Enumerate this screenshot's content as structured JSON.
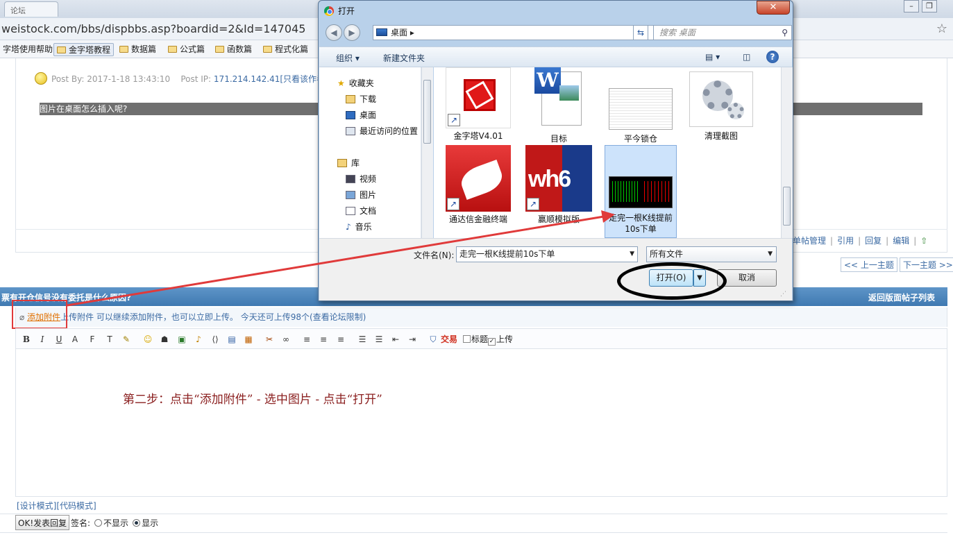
{
  "browser": {
    "url": "weistock.com/bbs/dispbbs.asp?boardid=2&Id=147045",
    "tab_label": "论坛",
    "bookmarks": [
      "字塔使用帮助",
      "金字塔教程",
      "数据篇",
      "公式篇",
      "函数篇",
      "程式化篇"
    ],
    "star_icon": "☆"
  },
  "post": {
    "by_label": "Post By:",
    "date": "2017-1-18 13:43:10",
    "ip_label": "Post IP:",
    "ip": "171.214.142.41",
    "only_author": "[只看该作者]",
    "question": "图片在桌面怎么插入呢?",
    "actions": [
      "单帖管理",
      "引用",
      "回复",
      "编辑"
    ],
    "prev_topic": "<< 上一主题",
    "next_topic": "下一主题 >>"
  },
  "reply": {
    "section_title": "票有开仓信号没有委托是什么原因?",
    "back_link": "返回版面帖子列表",
    "add_attachment": "添加附件",
    "attach_note": "上传附件 可以继续添加附件，也可以立即上传。 今天还可上传98个",
    "limit_link": "(查看论坛限制)",
    "toolbar": {
      "trade_label": "交易",
      "title_label": "标题",
      "upload_label": "上传"
    },
    "editor_text": "第二步：点击“添加附件” - 选中图片 - 点击“打开”",
    "design_mode": "[设计模式]",
    "code_mode": "[代码模式]",
    "submit": "OK!发表回复",
    "sig_label": "签名:",
    "sig_hide": "不显示",
    "sig_show": "显示"
  },
  "dialog": {
    "title": "打开",
    "close": "✕",
    "path": "桌面",
    "search_placeholder": "搜索 桌面",
    "organize": "组织 ▾",
    "new_folder": "新建文件夹",
    "nav": {
      "favorites": "收藏夹",
      "downloads": "下载",
      "desktop": "桌面",
      "recent": "最近访问的位置",
      "libraries": "库",
      "videos": "视频",
      "pictures": "图片",
      "documents": "文档",
      "music": "音乐"
    },
    "files": [
      {
        "name": "金字塔V4.01"
      },
      {
        "name": "目标"
      },
      {
        "name": "平今锁仓"
      },
      {
        "name": "清理截图"
      },
      {
        "name": "通达信金融终端"
      },
      {
        "name": "赢顺模拟版"
      },
      {
        "name": "走完一根K线提前10s下单"
      }
    ],
    "filename_label": "文件名(N):",
    "filename_value": "走完一根K线提前10s下单",
    "filetype": "所有文件",
    "open_button": "打开(O)",
    "cancel_button": "取消"
  },
  "colors": {
    "section_bar": "#3f79b1",
    "link": "#3b6aa3",
    "annotation": "#e03a3a",
    "step_text": "#8b2020"
  }
}
